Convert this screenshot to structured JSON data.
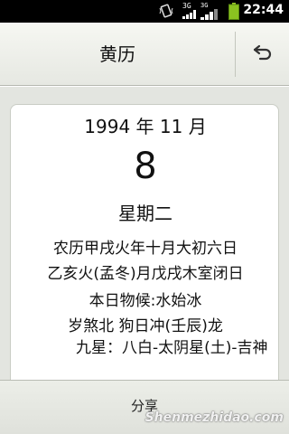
{
  "status_bar": {
    "time": "22:44",
    "network_label": "3G",
    "network_label_2": "3G",
    "icons": [
      "vibrate-icon",
      "signal-3g-icon",
      "signal-3g-2-icon",
      "battery-icon"
    ]
  },
  "header": {
    "title": "黄历",
    "back_icon": "back-arrow-icon"
  },
  "almanac": {
    "year_month": "1994 年 11 月",
    "day": "8",
    "weekday": "星期二",
    "lunar_date": "农历甲戌火年十月大初六日",
    "ganzhi": "乙亥火(孟冬)月戊戌木室闭日",
    "phenology": "本日物候:水始冰",
    "sha": "岁煞北 狗日冲(壬辰)龙",
    "jiuxing": "九星：八白-太阴星(土)-吉神"
  },
  "footer": {
    "share_label": "分享"
  },
  "watermark": "Shenmezhidao.com"
}
